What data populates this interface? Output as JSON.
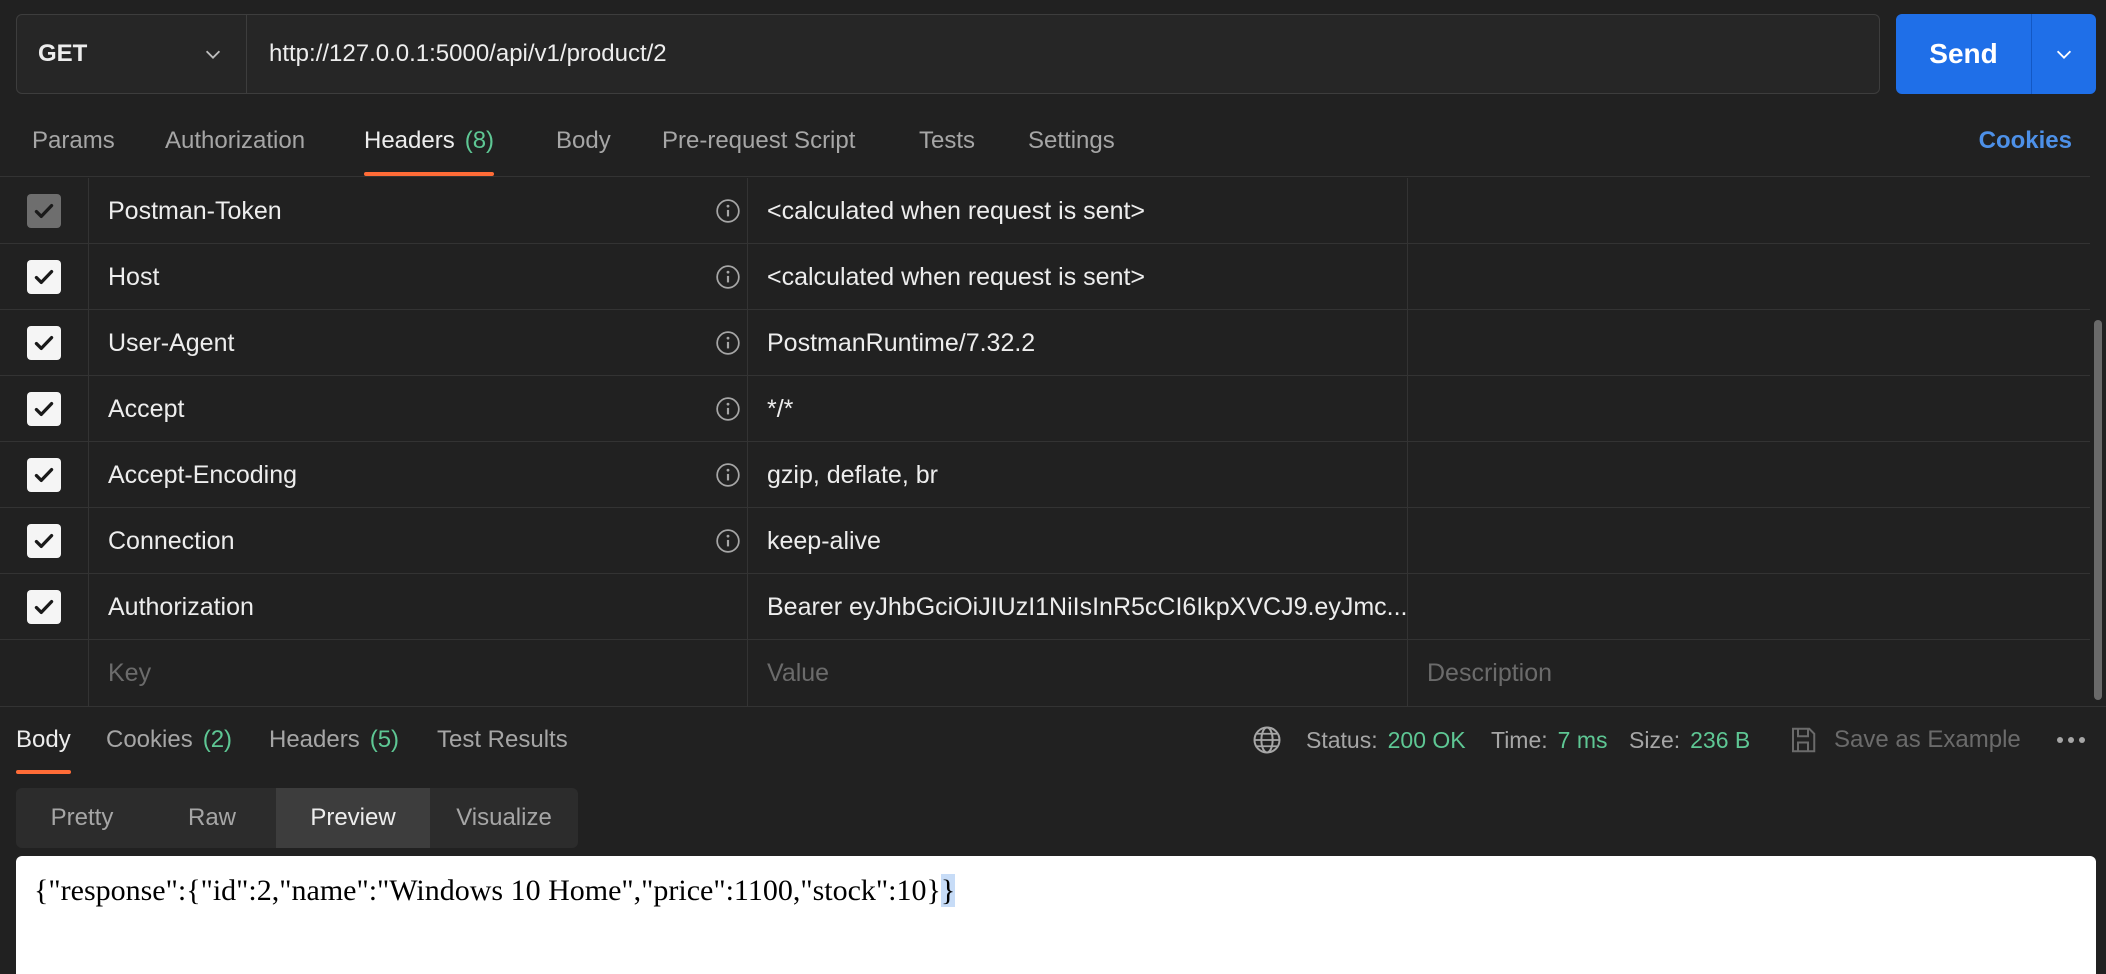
{
  "request": {
    "method": "GET",
    "url": "http://127.0.0.1:5000/api/v1/product/2",
    "send_label": "Send"
  },
  "request_tabs": [
    {
      "label": "Params",
      "count": ""
    },
    {
      "label": "Authorization",
      "count": ""
    },
    {
      "label": "Headers",
      "count": "(8)"
    },
    {
      "label": "Body",
      "count": ""
    },
    {
      "label": "Pre-request Script",
      "count": ""
    },
    {
      "label": "Tests",
      "count": ""
    },
    {
      "label": "Settings",
      "count": ""
    }
  ],
  "cookies_link": "Cookies",
  "headers": [
    {
      "key": "Postman-Token",
      "value": "<calculated when request is sent>",
      "checked": true,
      "disabled": true,
      "info": true
    },
    {
      "key": "Host",
      "value": "<calculated when request is sent>",
      "checked": true,
      "disabled": false,
      "info": true
    },
    {
      "key": "User-Agent",
      "value": "PostmanRuntime/7.32.2",
      "checked": true,
      "disabled": false,
      "info": true
    },
    {
      "key": "Accept",
      "value": "*/*",
      "checked": true,
      "disabled": false,
      "info": true
    },
    {
      "key": "Accept-Encoding",
      "value": "gzip, deflate, br",
      "checked": true,
      "disabled": false,
      "info": true
    },
    {
      "key": "Connection",
      "value": "keep-alive",
      "checked": true,
      "disabled": false,
      "info": true
    },
    {
      "key": "Authorization",
      "value": "Bearer eyJhbGciOiJIUzI1NiIsInR5cCI6IkpXVCJ9.eyJmc...",
      "checked": true,
      "disabled": false,
      "info": false
    }
  ],
  "new_row": {
    "key_placeholder": "Key",
    "value_placeholder": "Value",
    "desc_placeholder": "Description"
  },
  "response_tabs": [
    {
      "label": "Body",
      "count": ""
    },
    {
      "label": "Cookies",
      "count": "(2)"
    },
    {
      "label": "Headers",
      "count": "(5)"
    },
    {
      "label": "Test Results",
      "count": ""
    }
  ],
  "response_meta": {
    "status_label": "Status:",
    "status_value": "200 OK",
    "time_label": "Time:",
    "time_value": "7 ms",
    "size_label": "Size:",
    "size_value": "236 B",
    "save_example": "Save as Example"
  },
  "view_modes": [
    "Pretty",
    "Raw",
    "Preview",
    "Visualize"
  ],
  "preview": {
    "text_main": "{\"response\":{\"id\":2,\"name\":\"Windows 10 Home\",\"price\":1100,\"stock\":10}",
    "text_selected": "}"
  },
  "colors": {
    "accent_orange": "#ff6c37",
    "send_blue": "#1f6fe8",
    "success_green": "#5ec794",
    "link_blue": "#4d90e8"
  }
}
